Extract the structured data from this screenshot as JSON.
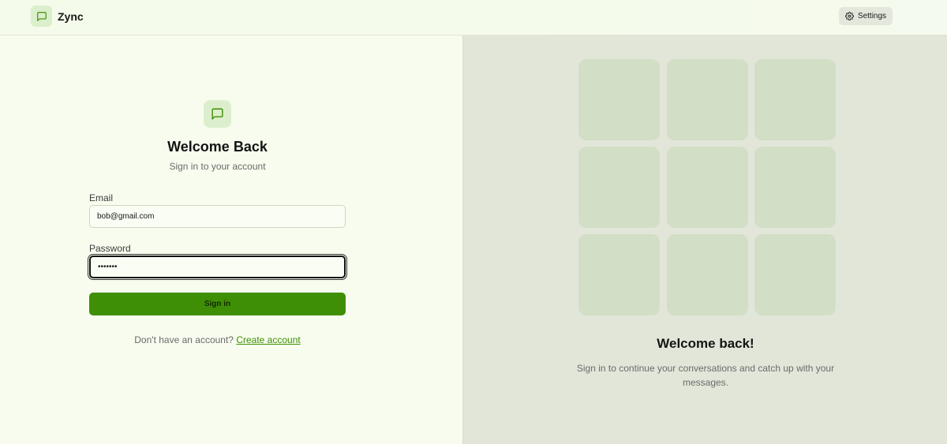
{
  "header": {
    "app_name": "Zync",
    "settings_label": "Settings"
  },
  "login": {
    "title": "Welcome Back",
    "subtitle": "Sign in to your account",
    "email_label": "Email",
    "email_value": "bob@gmail.com",
    "password_label": "Password",
    "password_value": "•••••••",
    "submit_label": "Sign in",
    "signup_prompt": "Don't have an account?",
    "signup_link": "Create account"
  },
  "promo": {
    "title": "Welcome back!",
    "description": "Sign in to continue your conversations and catch up with your messages."
  },
  "icons": {
    "logo": "message-square-icon",
    "settings": "gear-icon"
  },
  "colors": {
    "accent": "#3f8f06",
    "background": "#f7fcee",
    "panel": "#e2e6d9",
    "tile": "#d2dec5"
  }
}
